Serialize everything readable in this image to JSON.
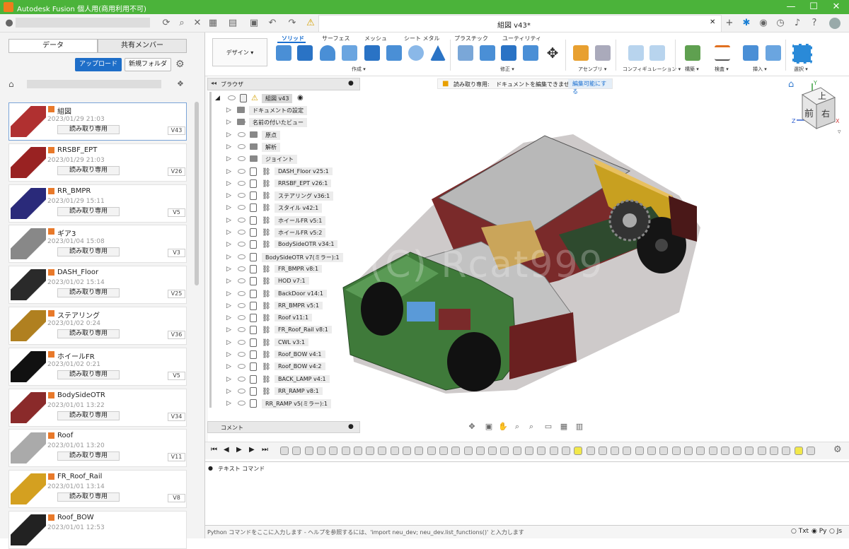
{
  "window": {
    "title": "Autodesk Fusion 個人用(商用利用不可)",
    "minimize": "—",
    "maximize": "☐",
    "close": "✕"
  },
  "document_tab": {
    "title": "組図 v43*",
    "close": "✕"
  },
  "data_panel": {
    "tabs": [
      "データ",
      "共有メンバー"
    ],
    "upload_label": "アップロード",
    "new_folder_label": "新規フォルダ",
    "files": [
      {
        "name": "組図",
        "date": "2023/01/29 21:03",
        "status": "読み取り専用",
        "version": "V43"
      },
      {
        "name": "RRSBF_EPT",
        "date": "2023/01/29 21:03",
        "status": "読み取り専用",
        "version": "V26"
      },
      {
        "name": "RR_BMPR",
        "date": "2023/01/29 15:11",
        "status": "読み取り専用",
        "version": "V5"
      },
      {
        "name": "ギア3",
        "date": "2023/01/04 15:08",
        "status": "読み取り専用",
        "version": "V3"
      },
      {
        "name": "DASH_Floor",
        "date": "2023/01/02 15:14",
        "status": "読み取り専用",
        "version": "V25"
      },
      {
        "name": "ステアリング",
        "date": "2023/01/02 0:24",
        "status": "読み取り専用",
        "version": "V36"
      },
      {
        "name": "ホイールFR",
        "date": "2023/01/02 0:21",
        "status": "読み取り専用",
        "version": "V5"
      },
      {
        "name": "BodySideOTR",
        "date": "2023/01/01 13:22",
        "status": "読み取り専用",
        "version": "V34"
      },
      {
        "name": "Roof",
        "date": "2023/01/01 13:20",
        "status": "読み取り専用",
        "version": "V11"
      },
      {
        "name": "FR_Roof_Rail",
        "date": "2023/01/01 13:14",
        "status": "読み取り専用",
        "version": "V8"
      },
      {
        "name": "Roof_BOW",
        "date": "2023/01/01 12:53",
        "status": "",
        "version": ""
      }
    ]
  },
  "ribbon": {
    "workspace": "デザイン ▾",
    "tabs": [
      "ソリッド",
      "サーフェス",
      "メッシュ",
      "シート メタル",
      "プラスチック",
      "ユーティリティ"
    ],
    "groups": [
      "作成 ▾",
      "修正 ▾",
      "アセンブリ ▾",
      "コンフィギュレーション ▾",
      "構築 ▾",
      "検査 ▾",
      "挿入 ▾",
      "選択 ▾"
    ]
  },
  "notice": {
    "title": "読み取り専用:",
    "text": "ドキュメントを編集できません",
    "button": "編集可能にする"
  },
  "browser": {
    "title": "ブラウザ",
    "root": "組図 v43",
    "items": [
      "ドキュメントの設定",
      "名前の付いたビュー",
      "原点",
      "解析",
      "ジョイント",
      "DASH_Floor v25:1",
      "RRSBF_EPT v26:1",
      "ステアリング v36:1",
      "スタイル v42:1",
      "ホイールFR v5:1",
      "ホイールFR v5:2",
      "BodySideOTR v34:1",
      "BodySideOTR v7(ミラー):1",
      "FR_BMPR v8:1",
      "HOD v7:1",
      "BackDoor v14:1",
      "RR_BMPR v5:1",
      "Roof v11:1",
      "FR_Roof_Rail v8:1",
      "CWL v3:1",
      "Roof_BOW v4:1",
      "Roof_BOW v4:2",
      "BACK_LAMP v4:1",
      "RR_RAMP v8:1",
      "RR_RAMP v5(ミラー):1"
    ]
  },
  "comment_label": "コメント",
  "viewcube": {
    "top": "上",
    "front": "前",
    "right": "右",
    "axis_x": "X",
    "axis_y": "Y",
    "axis_z": "Z"
  },
  "watermark": "(C) Rcat999",
  "text_command": {
    "title": "テキスト コマンド"
  },
  "python_bar": {
    "hint": "Python コマンドをここに入力します - ヘルプを参照するには、'import neu_dev; neu_dev.list_functions()' と入力します",
    "options": [
      "Txt",
      "Py",
      "Js"
    ]
  }
}
